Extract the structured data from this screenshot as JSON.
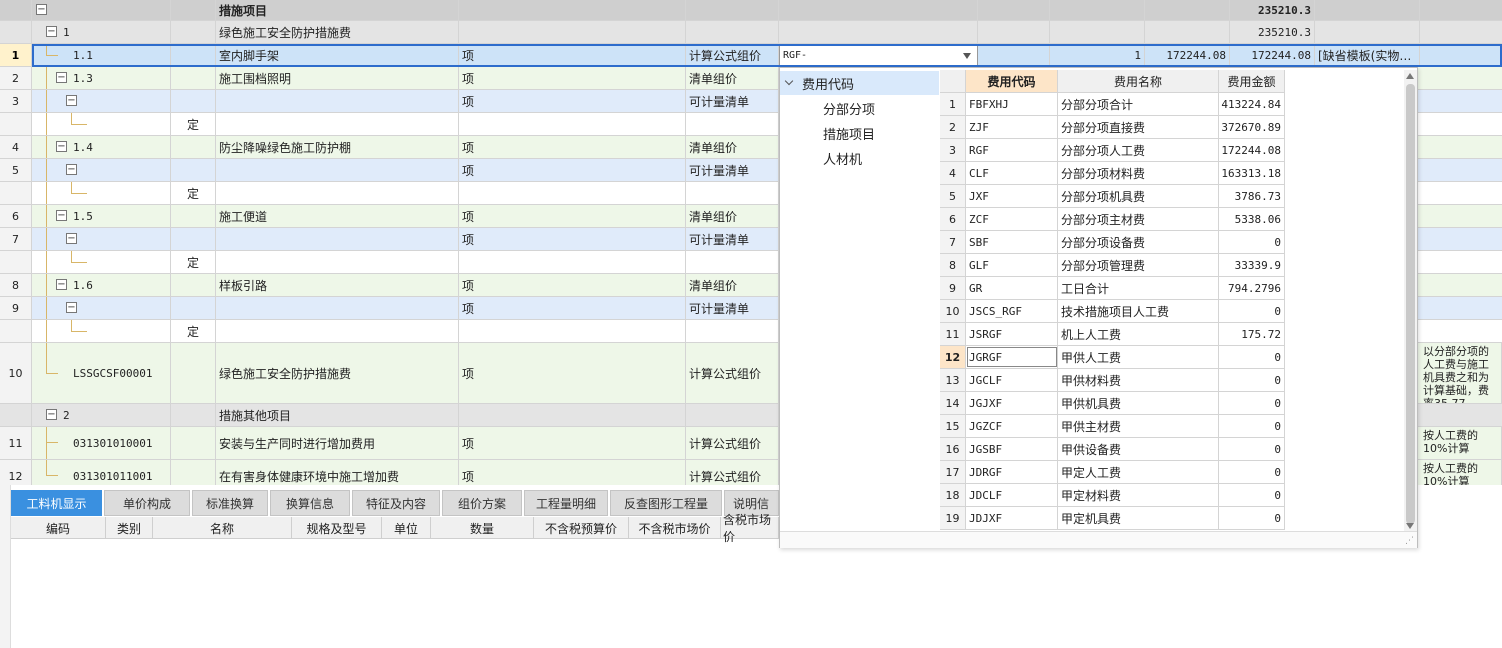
{
  "grid": {
    "header": {
      "title": "措施项目",
      "total": "235210.3"
    },
    "group1": {
      "code": "1",
      "name": "绿色施工安全防护措施费",
      "total": "235210.3"
    },
    "selected": {
      "rownum": "1",
      "code": "1.1",
      "name": "室内脚手架",
      "unit": "项",
      "category": "计算公式组价",
      "formula": "RGF-",
      "qty": "1",
      "price": "172244.08",
      "amount": "172244.08",
      "note": "[缺省模板(实物…"
    },
    "r2": {
      "rownum": "2",
      "code": "1.3",
      "name": "施工围档照明",
      "unit": "项",
      "category": "清单组价"
    },
    "r3": {
      "rownum": "3",
      "unit": "项",
      "category": "可计量清单"
    },
    "r3d": {
      "type": "定"
    },
    "r4": {
      "rownum": "4",
      "code": "1.4",
      "name": "防尘降噪绿色施工防护棚",
      "unit": "项",
      "category": "清单组价"
    },
    "r5": {
      "rownum": "5",
      "unit": "项",
      "category": "可计量清单"
    },
    "r5d": {
      "type": "定"
    },
    "r6": {
      "rownum": "6",
      "code": "1.5",
      "name": "施工便道",
      "unit": "项",
      "category": "清单组价"
    },
    "r7": {
      "rownum": "7",
      "unit": "项",
      "category": "可计量清单"
    },
    "r7d": {
      "type": "定"
    },
    "r8": {
      "rownum": "8",
      "code": "1.6",
      "name": "样板引路",
      "unit": "项",
      "category": "清单组价"
    },
    "r9": {
      "rownum": "9",
      "unit": "项",
      "category": "可计量清单"
    },
    "r9d": {
      "type": "定"
    },
    "r10": {
      "rownum": "10",
      "code": "LSSGCSF00001",
      "name": "绿色施工安全防护措施费",
      "unit": "项",
      "category": "计算公式组价",
      "note": "以分部分项的人工费与施工机具费之和为计算基础，费率35.77"
    },
    "group2": {
      "code": "2",
      "name": "措施其他项目"
    },
    "r11": {
      "rownum": "11",
      "code": "031301010001",
      "name": "安装与生产同时进行增加费用",
      "unit": "项",
      "category": "计算公式组价",
      "note": "按人工费的10%计算"
    },
    "r12": {
      "rownum": "12",
      "code": "031301011001",
      "name": "在有害身体健康环境中施工增加费",
      "unit": "项",
      "category": "计算公式组价",
      "note": "按人工费的10%计算"
    }
  },
  "tabs": [
    "工料机显示",
    "单价构成",
    "标准换算",
    "换算信息",
    "特征及内容",
    "组价方案",
    "工程量明细",
    "反查图形工程量",
    "说明信"
  ],
  "bottom_headers": [
    "编码",
    "类别",
    "名称",
    "规格及型号",
    "单位",
    "数量",
    "不含税预算价",
    "不含税市场价",
    "含税市场价"
  ],
  "popup": {
    "tree": {
      "root": "费用代码",
      "children": [
        "分部分项",
        "措施项目",
        "人材机"
      ]
    },
    "headers": {
      "code": "费用代码",
      "name": "费用名称",
      "amount": "费用金额"
    },
    "rows": [
      {
        "n": "1",
        "code": "FBFXHJ",
        "name": "分部分项合计",
        "amount": "413224.84"
      },
      {
        "n": "2",
        "code": "ZJF",
        "name": "分部分项直接费",
        "amount": "372670.89"
      },
      {
        "n": "3",
        "code": "RGF",
        "name": "分部分项人工费",
        "amount": "172244.08"
      },
      {
        "n": "4",
        "code": "CLF",
        "name": "分部分项材料费",
        "amount": "163313.18"
      },
      {
        "n": "5",
        "code": "JXF",
        "name": "分部分项机具费",
        "amount": "3786.73"
      },
      {
        "n": "6",
        "code": "ZCF",
        "name": "分部分项主材费",
        "amount": "5338.06"
      },
      {
        "n": "7",
        "code": "SBF",
        "name": "分部分项设备费",
        "amount": "0"
      },
      {
        "n": "8",
        "code": "GLF",
        "name": "分部分项管理费",
        "amount": "33339.9"
      },
      {
        "n": "9",
        "code": "GR",
        "name": "工日合计",
        "amount": "794.2796"
      },
      {
        "n": "10",
        "code": "JSCS_RGF",
        "name": "技术措施项目人工费",
        "amount": "0"
      },
      {
        "n": "11",
        "code": "JSRGF",
        "name": "机上人工费",
        "amount": "175.72"
      },
      {
        "n": "12",
        "code": "JGRGF",
        "name": "甲供人工费",
        "amount": "0"
      },
      {
        "n": "13",
        "code": "JGCLF",
        "name": "甲供材料费",
        "amount": "0"
      },
      {
        "n": "14",
        "code": "JGJXF",
        "name": "甲供机具费",
        "amount": "0"
      },
      {
        "n": "15",
        "code": "JGZCF",
        "name": "甲供主材费",
        "amount": "0"
      },
      {
        "n": "16",
        "code": "JGSBF",
        "name": "甲供设备费",
        "amount": "0"
      },
      {
        "n": "17",
        "code": "JDRGF",
        "name": "甲定人工费",
        "amount": "0"
      },
      {
        "n": "18",
        "code": "JDCLF",
        "name": "甲定材料费",
        "amount": "0"
      },
      {
        "n": "19",
        "code": "JDJXF",
        "name": "甲定机具费",
        "amount": "0"
      }
    ]
  },
  "icons": {
    "expand": "minus-box-icon",
    "collapse": "chevron-down-icon",
    "dropdown": "triangle-down-icon",
    "resize": "resize-grip-icon"
  },
  "colors": {
    "selected_row": "#cde3f8",
    "detail_row": "#eef7e8",
    "sub_row": "#e0ebfa",
    "group_row": "#dcdcdc",
    "active_tab": "#3a90e0",
    "tree_line": "#d8b668",
    "header_highlight": "#fde5c8"
  }
}
